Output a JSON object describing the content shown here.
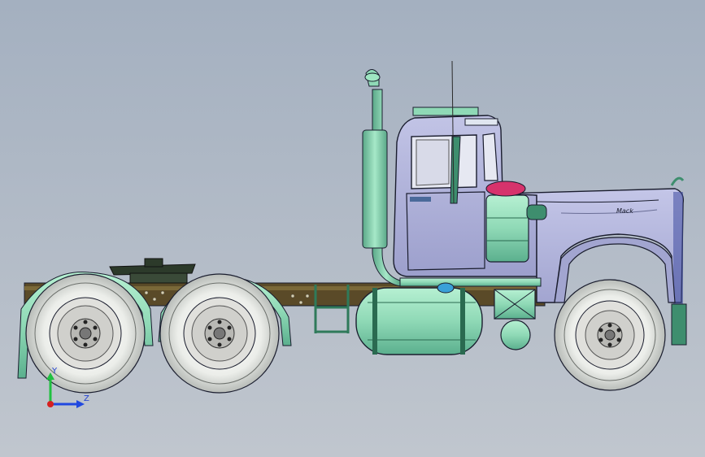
{
  "viewport": {
    "background_top": "#a4b0c0",
    "background_bottom": "#c0c6ce"
  },
  "colors": {
    "body_lavender": "#aeb1d6",
    "edge": "#1a1d2e",
    "aqua": "#8fd9b6",
    "aqua_dark": "#3e8e6e",
    "frame_brown": "#5a4a28",
    "tire_white": "#eeeeea",
    "rim_light": "#d8d8d4",
    "beacon_red": "#d6336c",
    "badge_blue": "#3aa0d8"
  },
  "model": {
    "cab_logo": "Mack",
    "icons": [
      "truck-model",
      "fuel-tank",
      "air-filter",
      "exhaust-stack",
      "fifth-wheel",
      "battery-box"
    ]
  },
  "triad": {
    "y_label": "Y",
    "z_label": "Z",
    "x_color": "#d62020",
    "y_color": "#20c040",
    "z_color": "#2048e0"
  }
}
